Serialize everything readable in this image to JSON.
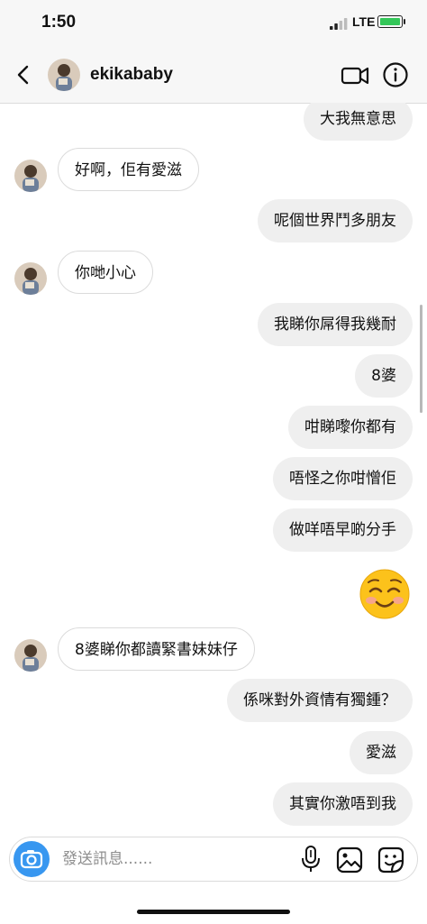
{
  "status": {
    "time": "1:50",
    "network": "LTE"
  },
  "header": {
    "username": "ekikababy"
  },
  "messages": [
    {
      "side": "out",
      "text": "大我無意思"
    },
    {
      "side": "in",
      "text": "好啊，佢有愛滋"
    },
    {
      "side": "out",
      "text": "呢個世界鬥多朋友"
    },
    {
      "side": "in",
      "text": "你哋小心"
    },
    {
      "side": "out",
      "text": "我睇你屌得我幾耐"
    },
    {
      "side": "out",
      "text": "8婆"
    },
    {
      "side": "out",
      "text": "咁睇嚟你都有"
    },
    {
      "side": "out",
      "text": "唔怪之你咁憎佢"
    },
    {
      "side": "out",
      "text": "做咩唔早啲分手"
    },
    {
      "side": "out",
      "emoji": "smiling-face-icon"
    },
    {
      "side": "in",
      "text": "8婆睇你都讀緊書妹妹仔"
    },
    {
      "side": "out",
      "text": "係咪對外資情有獨鍾？"
    },
    {
      "side": "out",
      "text": "愛滋"
    },
    {
      "side": "out",
      "text": "其實你激唔到我"
    }
  ],
  "composer": {
    "placeholder": "發送訊息......"
  },
  "colors": {
    "accent": "#3897f0",
    "outgoing_bubble": "#efefef",
    "battery": "#34c759"
  }
}
